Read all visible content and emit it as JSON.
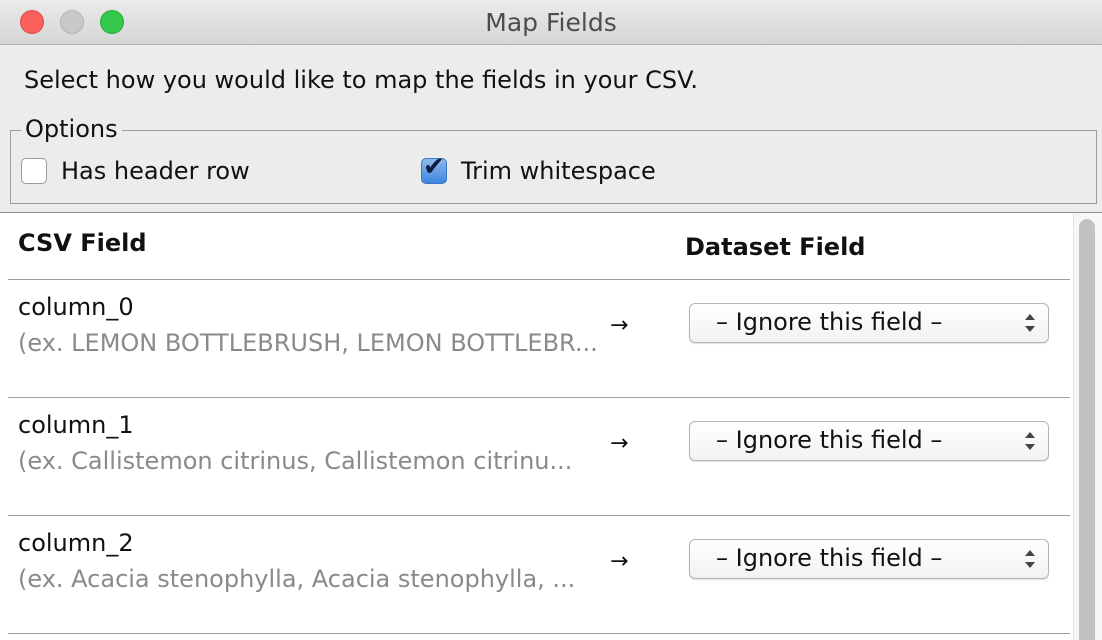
{
  "window": {
    "title": "Map Fields"
  },
  "instructions": "Select how you would like to map the fields in your CSV.",
  "options": {
    "legend": "Options",
    "has_header_row": {
      "label": "Has header row",
      "checked": false
    },
    "trim_whitespace": {
      "label": "Trim whitespace",
      "checked": true
    }
  },
  "table": {
    "headers": {
      "csv_field": "CSV Field",
      "dataset_field": "Dataset Field"
    },
    "rows": [
      {
        "name": "column_0",
        "example": "(ex. LEMON BOTTLEBRUSH, LEMON BOTTLEBR...",
        "arrow": "→",
        "mapping": "– Ignore this field –"
      },
      {
        "name": "column_1",
        "example": "(ex. Callistemon citrinus, Callistemon citrinu...",
        "arrow": "→",
        "mapping": "– Ignore this field –"
      },
      {
        "name": "column_2",
        "example": "(ex. Acacia stenophylla, Acacia stenophylla, ...",
        "arrow": "→",
        "mapping": "– Ignore this field –"
      }
    ]
  },
  "icons": {
    "close": "close-icon",
    "minimize": "minimize-icon",
    "maximize": "maximize-icon",
    "checkmark": "checkmark-icon",
    "select_chevrons": "chevron-up-down-icon"
  },
  "colors": {
    "close": "#fc605c",
    "minimize": "#c8c8c8",
    "maximize": "#34c84a",
    "checkbox_checked": "#3e86e0",
    "example_text": "#8a8a8a"
  }
}
